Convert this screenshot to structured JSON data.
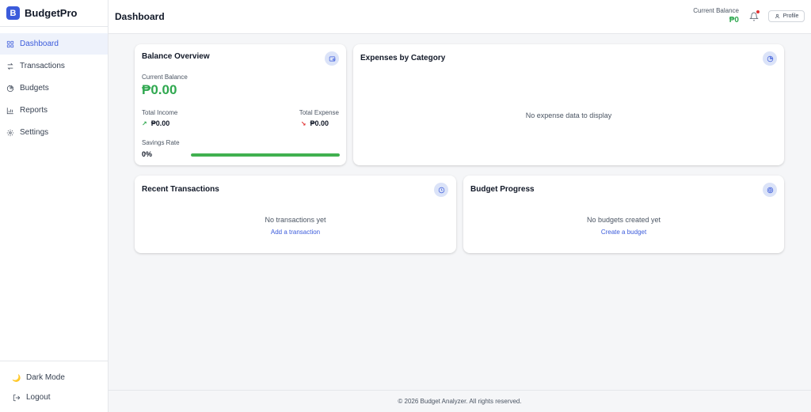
{
  "brand": {
    "logo_letter": "B",
    "name": "BudgetPro",
    "accent": "#3b5bdb"
  },
  "sidebar": {
    "items": [
      {
        "label": "Dashboard",
        "icon": "grid-icon",
        "active": true
      },
      {
        "label": "Transactions",
        "icon": "arrows-swap-icon",
        "active": false
      },
      {
        "label": "Budgets",
        "icon": "pie-chart-icon",
        "active": false
      },
      {
        "label": "Reports",
        "icon": "bar-chart-icon",
        "active": false
      },
      {
        "label": "Settings",
        "icon": "gear-icon",
        "active": false
      }
    ],
    "dark_mode_label": "Dark Mode",
    "logout_label": "Logout"
  },
  "header": {
    "title": "Dashboard",
    "balance_label": "Current Balance",
    "balance_value": "₱0",
    "profile_label": "Profile"
  },
  "balance_overview": {
    "title": "Balance Overview",
    "current_balance_label": "Current Balance",
    "current_balance_value": "₱0.00",
    "total_income_label": "Total Income",
    "total_income_value": "₱0.00",
    "total_expense_label": "Total Expense",
    "total_expense_value": "₱0.00",
    "savings_rate_label": "Savings Rate",
    "savings_rate_value": "0%"
  },
  "expenses_by_category": {
    "title": "Expenses by Category",
    "empty_message": "No expense data to display"
  },
  "recent_transactions": {
    "title": "Recent Transactions",
    "empty_message": "No transactions yet",
    "action_label": "Add a transaction"
  },
  "budget_progress": {
    "title": "Budget Progress",
    "empty_message": "No budgets created yet",
    "action_label": "Create a budget"
  },
  "footer": {
    "text": "© 2026 Budget Analyzer. All rights reserved."
  },
  "colors": {
    "positive": "#2fa84f",
    "negative": "#e03131",
    "icon_bg": "#dbe3f8"
  }
}
